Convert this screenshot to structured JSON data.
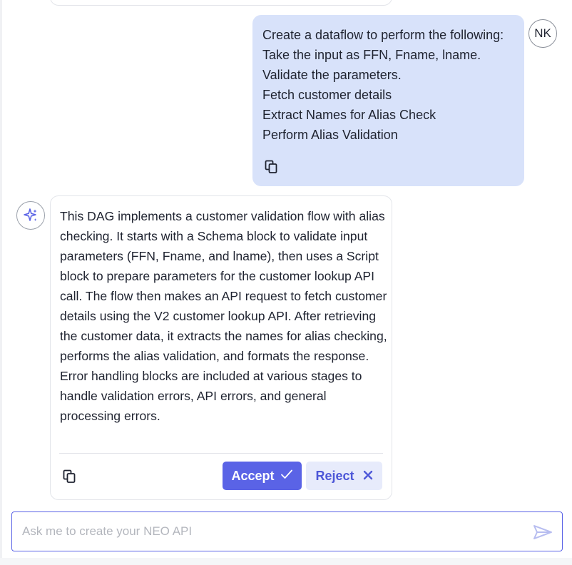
{
  "user_message": {
    "lines": [
      "Create a dataflow to perform the following:",
      "Take the input as FFN, Fname, lname.",
      "Validate the parameters.",
      "Fetch customer details",
      "Extract Names for Alias Check",
      "Perform Alias Validation"
    ],
    "avatar_initials": "NK",
    "copy_icon": "copy-icon"
  },
  "assistant_message": {
    "icon": "sparkle-icon",
    "text": "This DAG implements a customer validation flow with alias checking. It starts with a Schema block to validate input parameters (FFN, Fname, and lname), then uses a Script block to prepare parameters for the customer lookup API call. The flow then makes an API request to fetch customer details using the V2 customer lookup API. After retrieving the customer data, it extracts the names for alias checking, performs the alias validation, and formats the response. Error handling blocks are included at various stages to handle validation errors, API errors, and general processing errors.",
    "accept_label": "Accept",
    "reject_label": "Reject",
    "copy_icon": "copy-icon"
  },
  "composer": {
    "placeholder": "Ask me to create your NEO API",
    "value": "",
    "send_icon": "send-icon"
  },
  "colors": {
    "accent": "#5a63e6",
    "user_bubble": "#d8e2fa",
    "reject_bg": "#e7ebfb"
  }
}
